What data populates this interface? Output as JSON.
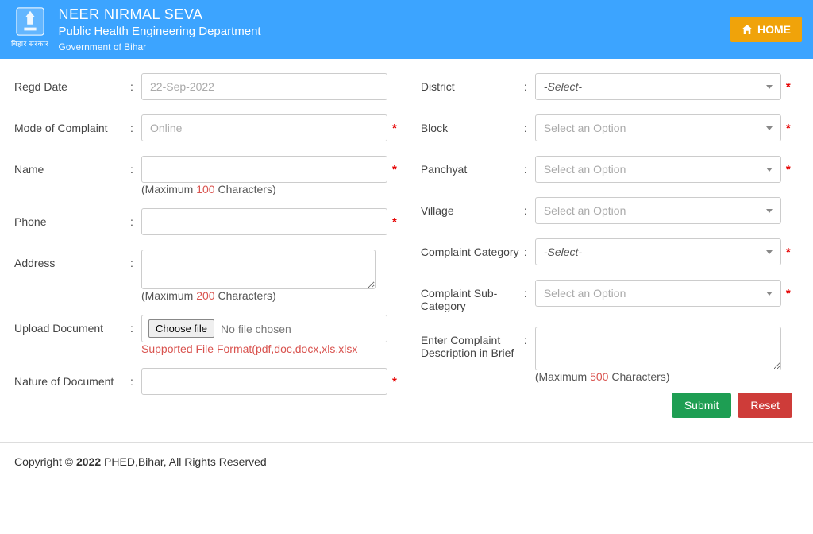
{
  "header": {
    "title": "NEER NIRMAL SEVA",
    "dept": "Public Health Engineering Department",
    "gov": "Government of Bihar",
    "logoSub": "बिहार सरकार",
    "home": "HOME"
  },
  "labels": {
    "regdDate": "Regd Date",
    "mode": "Mode of Complaint",
    "name": "Name",
    "phone": "Phone",
    "address": "Address",
    "upload": "Upload Document",
    "nature": "Nature of Document",
    "district": "District",
    "block": "Block",
    "panchyat": "Panchyat",
    "village": "Village",
    "category": "Complaint Category",
    "subcategory": "Complaint Sub-Category",
    "desc": "Enter Complaint Description in Brief"
  },
  "values": {
    "regdDate": "22-Sep-2022",
    "mode": "Online",
    "fileButton": "Choose file",
    "fileText": "No file chosen",
    "district": "-Select-",
    "block": "Select an Option",
    "panchyat": "Select an Option",
    "village": "Select an Option",
    "category": "-Select-",
    "subcategory": "Select an Option"
  },
  "hints": {
    "nameMaxPre": "(Maximum ",
    "nameMaxNum": "100",
    "nameMaxPost": " Characters)",
    "addrMaxNum": "200",
    "descMaxNum": "500",
    "fileFormats": "Supported File Format(pdf,doc,docx,xls,xlsx"
  },
  "buttons": {
    "submit": "Submit",
    "reset": "Reset"
  },
  "footer": {
    "pre": "Copyright © ",
    "year": "2022",
    "post": " PHED,Bihar, All Rights Reserved"
  }
}
